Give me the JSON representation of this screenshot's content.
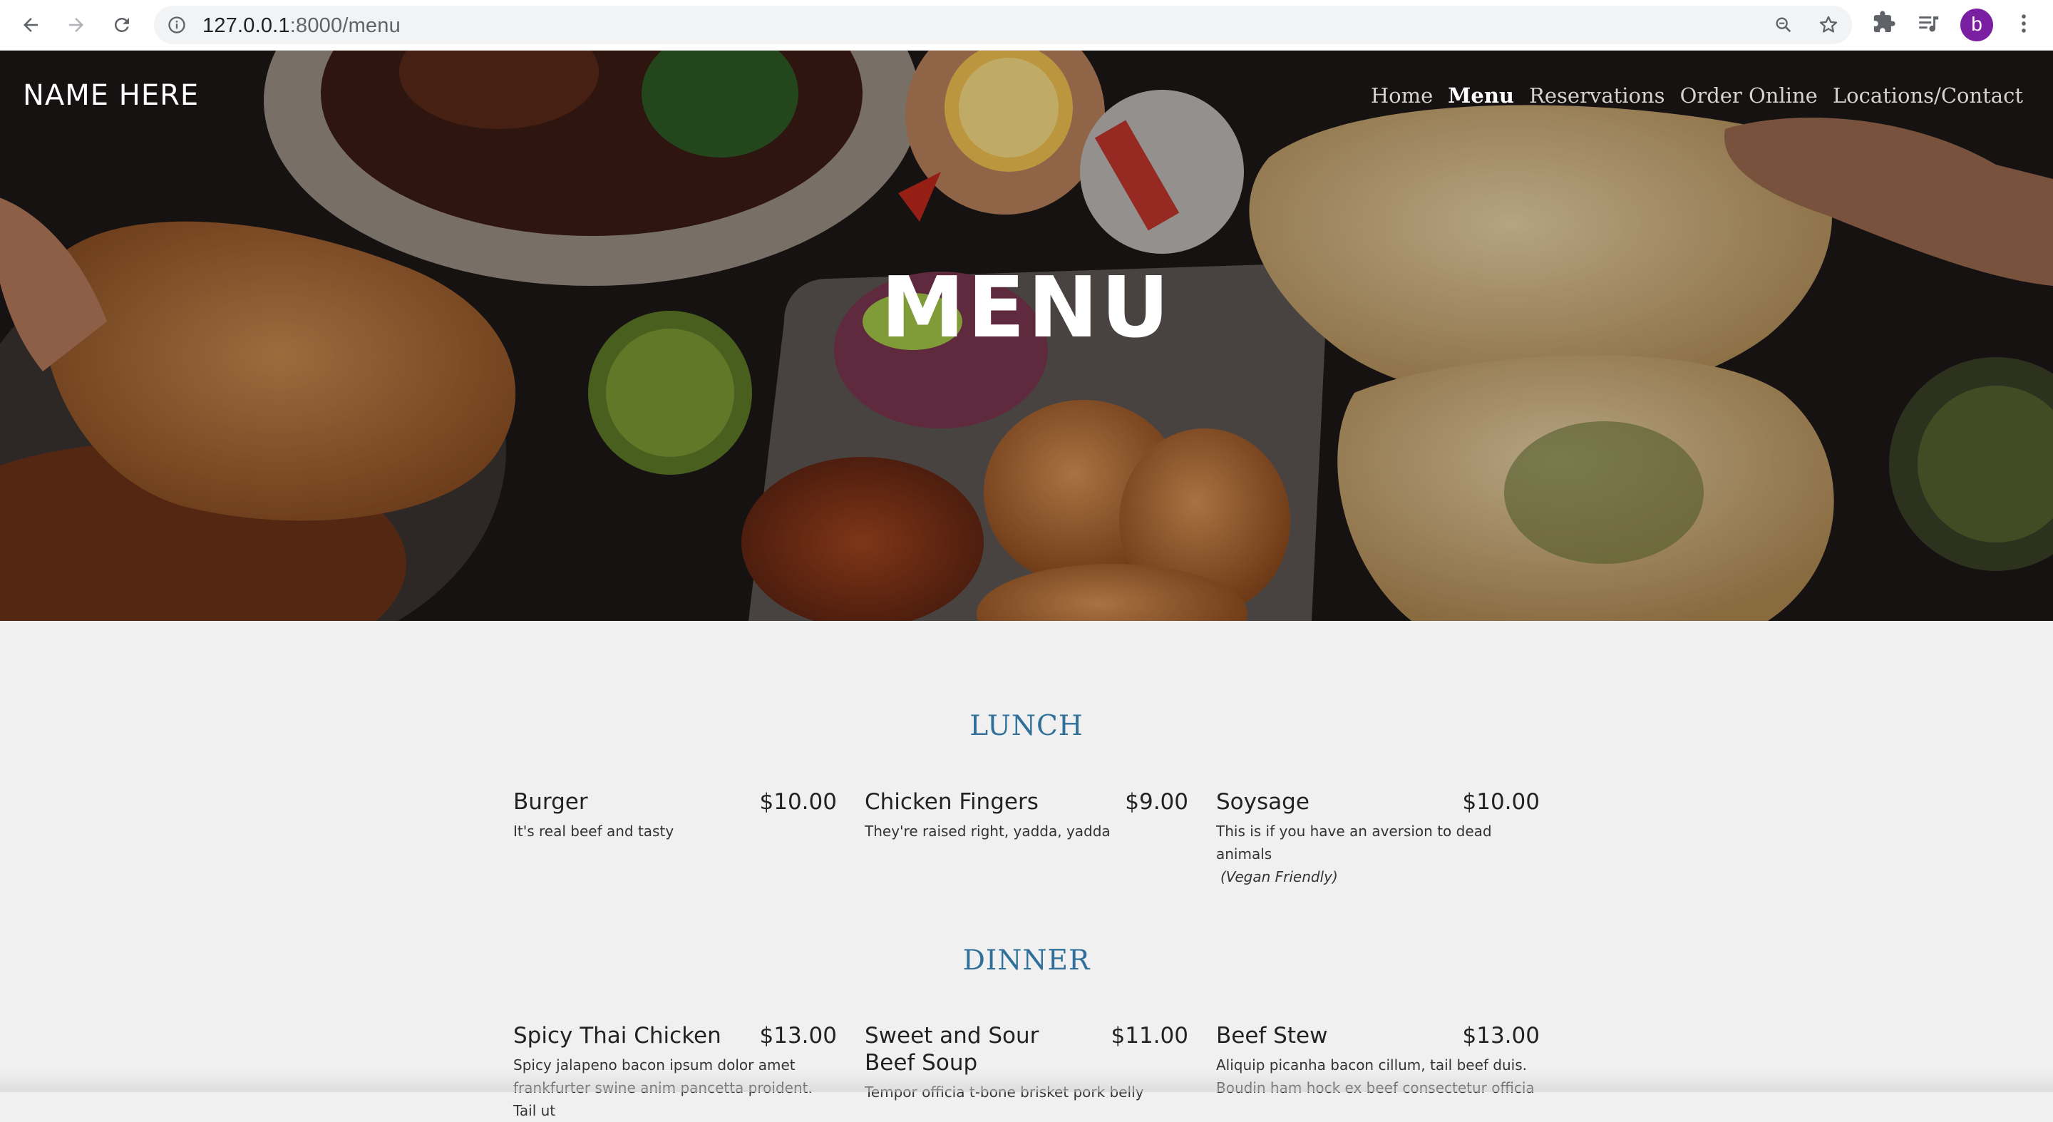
{
  "browser": {
    "url_host": "127.0.0.1",
    "url_rest": ":8000/menu",
    "profile_initial": "b"
  },
  "header": {
    "brand": "NAME HERE",
    "nav": [
      "Home",
      "Menu",
      "Reservations",
      "Order Online",
      "Locations/Contact"
    ],
    "active_nav": "Menu"
  },
  "hero": {
    "title": "MENU"
  },
  "menu": {
    "lunch": {
      "title": "LUNCH",
      "items": [
        {
          "name": "Burger",
          "price": "$10.00",
          "desc": "It's real beef and tasty",
          "note": ""
        },
        {
          "name": "Chicken Fingers",
          "price": "$9.00",
          "desc": "They're raised right, yadda, yadda",
          "note": ""
        },
        {
          "name": "Soysage",
          "price": "$10.00",
          "desc": "This is if you have an aversion to dead animals",
          "note": "(Vegan Friendly)"
        }
      ]
    },
    "dinner": {
      "title": "DINNER",
      "items": [
        {
          "name": "Spicy Thai Chicken",
          "price": "$13.00",
          "desc": "Spicy jalapeno bacon ipsum dolor amet frankfurter swine anim pancetta proident. Tail ut",
          "note": ""
        },
        {
          "name": "Sweet and Sour Beef Soup",
          "price": "$11.00",
          "desc": "Tempor officia t-bone brisket pork belly",
          "note": ""
        },
        {
          "name": "Beef Stew",
          "price": "$13.00",
          "desc": "Aliquip picanha bacon cillum, tail beef duis. Boudin ham hock ex beef consectetur officia",
          "note": ""
        }
      ]
    }
  },
  "colors": {
    "section_title": "#2f6f9a",
    "page_bg": "#f0f0f0",
    "avatar": "#7b1fa2"
  },
  "icons": [
    "back-icon",
    "forward-icon",
    "reload-icon",
    "info-icon",
    "zoom-icon",
    "star-icon",
    "extensions-icon",
    "media-icon",
    "kebab-menu-icon"
  ]
}
